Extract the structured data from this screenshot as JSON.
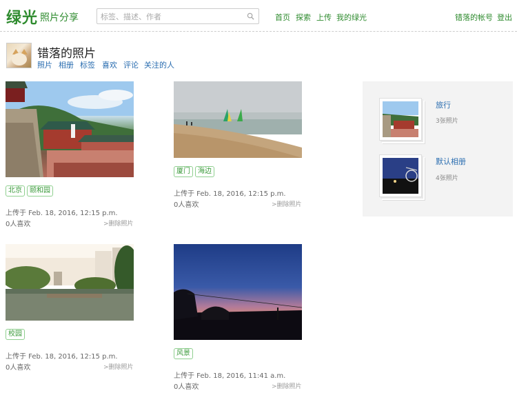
{
  "header": {
    "logo": "绿光",
    "logo_sub": "照片分享",
    "search_placeholder": "标签、描述、作者",
    "nav": [
      "首页",
      "探索",
      "上传",
      "我的绿光"
    ],
    "account": "错落的帐号",
    "logout": "登出"
  },
  "profile": {
    "name": "错落的照片",
    "tabs": [
      "照片",
      "相册",
      "标签",
      "喜欢",
      "评论",
      "关注的人"
    ]
  },
  "photos": [
    {
      "tags": [
        "北京",
        "颐和园"
      ],
      "uploaded": "上传于 Feb. 18, 2016, 12:15 p.m.",
      "likes": "0人喜欢",
      "delete": ">删除照片"
    },
    {
      "tags": [
        "厦门",
        "海边"
      ],
      "uploaded": "上传于 Feb. 18, 2016, 12:15 p.m.",
      "likes": "0人喜欢",
      "delete": ">删除照片"
    },
    {
      "tags": [
        "校园"
      ],
      "uploaded": "上传于 Feb. 18, 2016, 12:15 p.m.",
      "likes": "0人喜欢",
      "delete": ">删除照片"
    },
    {
      "tags": [
        "风景"
      ],
      "uploaded": "上传于 Feb. 18, 2016, 11:41 a.m.",
      "likes": "0人喜欢",
      "delete": ">删除照片"
    }
  ],
  "albums": [
    {
      "name": "旅行",
      "count": "3张照片"
    },
    {
      "name": "默认相册",
      "count": "4张照片"
    }
  ],
  "colors": {
    "brand": "#2e8b2e",
    "link": "#2a6db0"
  }
}
